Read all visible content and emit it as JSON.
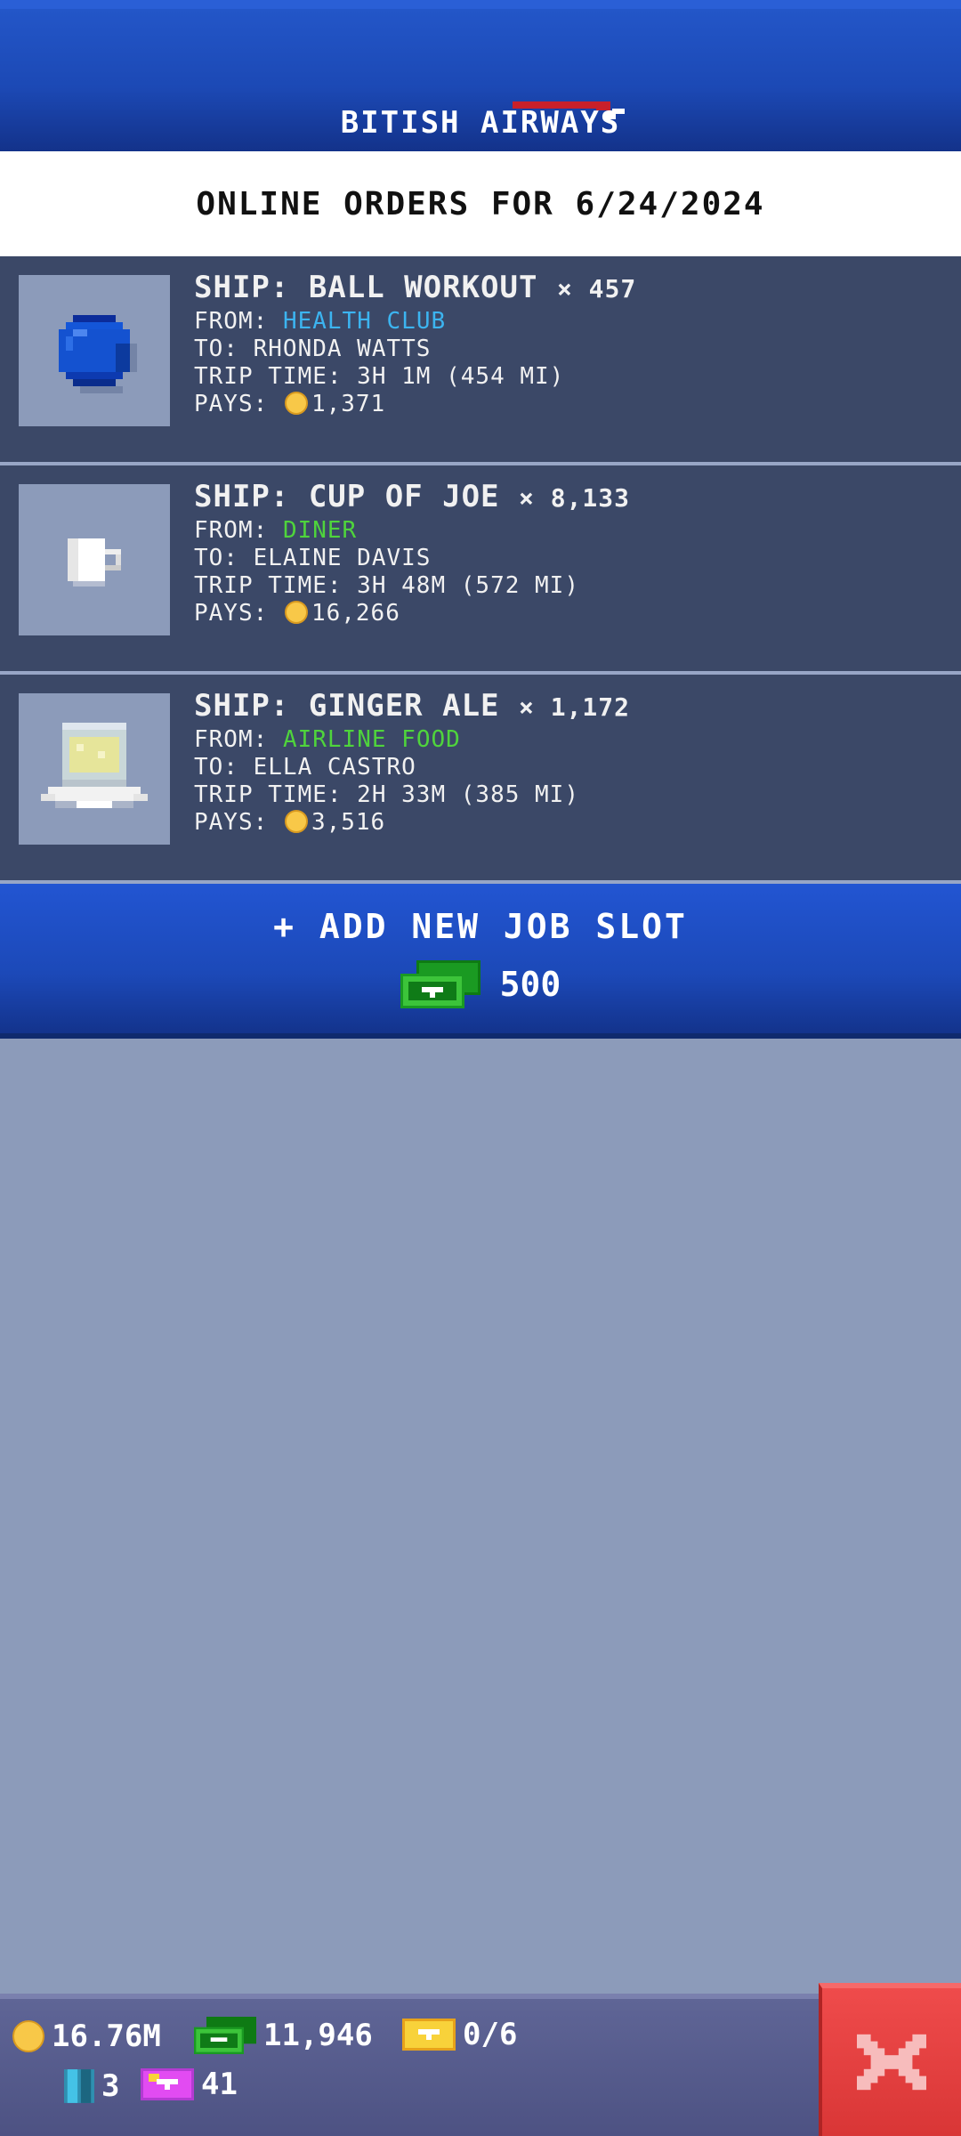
{
  "header": {
    "title": "BITISH AIRWAYS",
    "colors": {
      "background": "#1c49b5",
      "accent": "#c8202a"
    }
  },
  "date_banner": "ONLINE ORDERS FOR 6/24/2024",
  "jobs": [
    {
      "item_icon": "blue-ball-icon",
      "ship": "SHIP: BALL WORKOUT",
      "qty": "× 457",
      "from_label": "FROM:",
      "from": "HEALTH CLUB",
      "from_color": "#3cb4f0",
      "to": "TO: RHONDA WATTS",
      "trip": "TRIP TIME: 3H 1M (454 MI)",
      "pays_label": "PAYS:",
      "pays": "1,371"
    },
    {
      "item_icon": "coffee-cup-icon",
      "ship": "SHIP: CUP OF JOE",
      "qty": "× 8,133",
      "from_label": "FROM:",
      "from": "DINER",
      "from_color": "#4fd43c",
      "to": "TO: ELAINE DAVIS",
      "trip": "TRIP TIME: 3H 48M (572 MI)",
      "pays_label": "PAYS:",
      "pays": "16,266"
    },
    {
      "item_icon": "ginger-ale-glass-icon",
      "ship": "SHIP: GINGER ALE",
      "qty": "× 1,172",
      "from_label": "FROM:",
      "from": "AIRLINE FOOD",
      "from_color": "#4fd43c",
      "to": "TO: ELLA CASTRO",
      "trip": "TRIP TIME: 2H 33M (385 MI)",
      "pays_label": "PAYS:",
      "pays": "3,516"
    }
  ],
  "add_slot": {
    "label": "+ ADD NEW JOB SLOT",
    "cost": "500",
    "cost_icon": "bux-icon"
  },
  "status_bar": {
    "coins": "16.76M",
    "bux": "11,946",
    "tickets": "0/6",
    "elevators": "3",
    "vip": "41"
  },
  "close_button": {
    "icon": "close-x-icon"
  }
}
